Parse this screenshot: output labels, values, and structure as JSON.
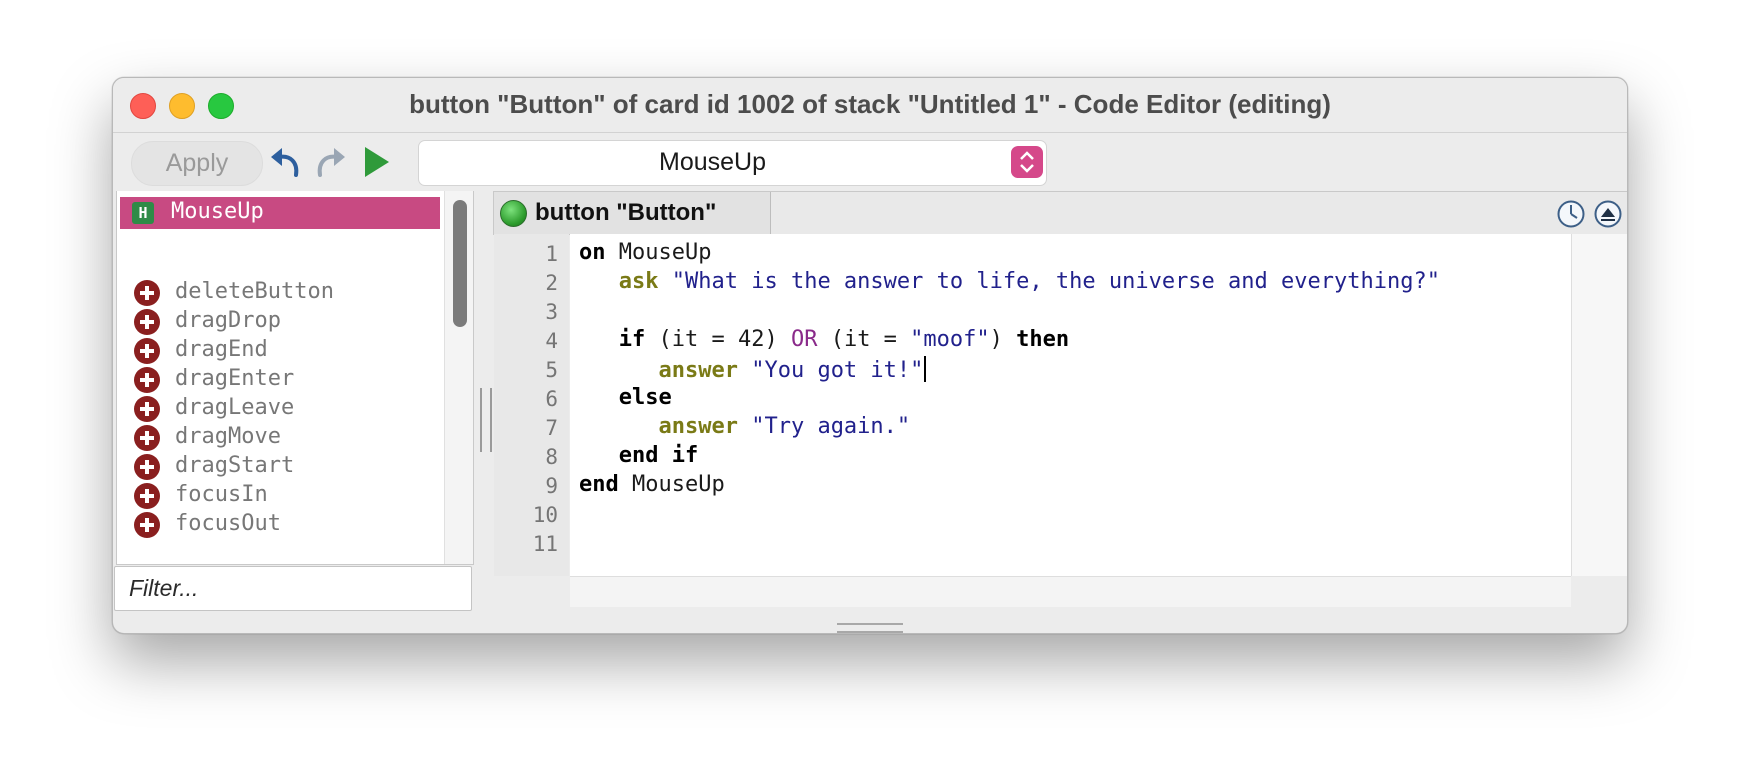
{
  "window": {
    "title": "button \"Button\" of card id 1002 of stack \"Untitled 1\" - Code Editor (editing)"
  },
  "toolbar": {
    "apply_label": "Apply",
    "selected_handler": "MouseUp",
    "icons": [
      "undo-icon",
      "redo-icon",
      "run-icon",
      "stepper-icon"
    ]
  },
  "handler_list": {
    "defined": [
      {
        "badge": "H",
        "name": "MouseUp"
      }
    ],
    "messages": [
      "deleteButton",
      "dragDrop",
      "dragEnd",
      "dragEnter",
      "dragLeave",
      "dragMove",
      "dragStart",
      "focusIn",
      "focusOut"
    ]
  },
  "filter": {
    "placeholder": "Filter..."
  },
  "editor": {
    "object_label": "button \"Button\"",
    "line_numbers": [
      "1",
      "2",
      "3",
      "4",
      "5",
      "6",
      "7",
      "8",
      "9",
      "10",
      "11"
    ],
    "code": [
      [
        {
          "t": "on",
          "c": "kw"
        },
        {
          "t": " MouseUp",
          "c": ""
        }
      ],
      [
        {
          "t": "   ",
          "c": ""
        },
        {
          "t": "ask",
          "c": "cmd"
        },
        {
          "t": " ",
          "c": ""
        },
        {
          "t": "\"What is the answer to life, the universe and everything?\"",
          "c": "str"
        }
      ],
      [],
      [
        {
          "t": "   ",
          "c": ""
        },
        {
          "t": "if",
          "c": "kw"
        },
        {
          "t": " (it = 42) ",
          "c": ""
        },
        {
          "t": "OR",
          "c": "op"
        },
        {
          "t": " (it = ",
          "c": ""
        },
        {
          "t": "\"moof\"",
          "c": "str"
        },
        {
          "t": ") ",
          "c": ""
        },
        {
          "t": "then",
          "c": "kw"
        }
      ],
      [
        {
          "t": "      ",
          "c": ""
        },
        {
          "t": "answer",
          "c": "cmd"
        },
        {
          "t": " ",
          "c": ""
        },
        {
          "t": "\"You got it!\"",
          "c": "str"
        }
      ],
      [
        {
          "t": "   ",
          "c": ""
        },
        {
          "t": "else",
          "c": "kw"
        }
      ],
      [
        {
          "t": "      ",
          "c": ""
        },
        {
          "t": "answer",
          "c": "cmd"
        },
        {
          "t": " ",
          "c": ""
        },
        {
          "t": "\"Try again.\"",
          "c": "str"
        }
      ],
      [
        {
          "t": "   ",
          "c": ""
        },
        {
          "t": "end if",
          "c": "kw"
        }
      ],
      [
        {
          "t": "end",
          "c": "kw"
        },
        {
          "t": " MouseUp",
          "c": ""
        }
      ],
      [],
      []
    ],
    "caret_line": 5
  },
  "colors": {
    "accent": "#c84a82",
    "keyword": "#000000",
    "command": "#7a7a16",
    "string": "#21218c",
    "operator": "#8a2a8a"
  }
}
